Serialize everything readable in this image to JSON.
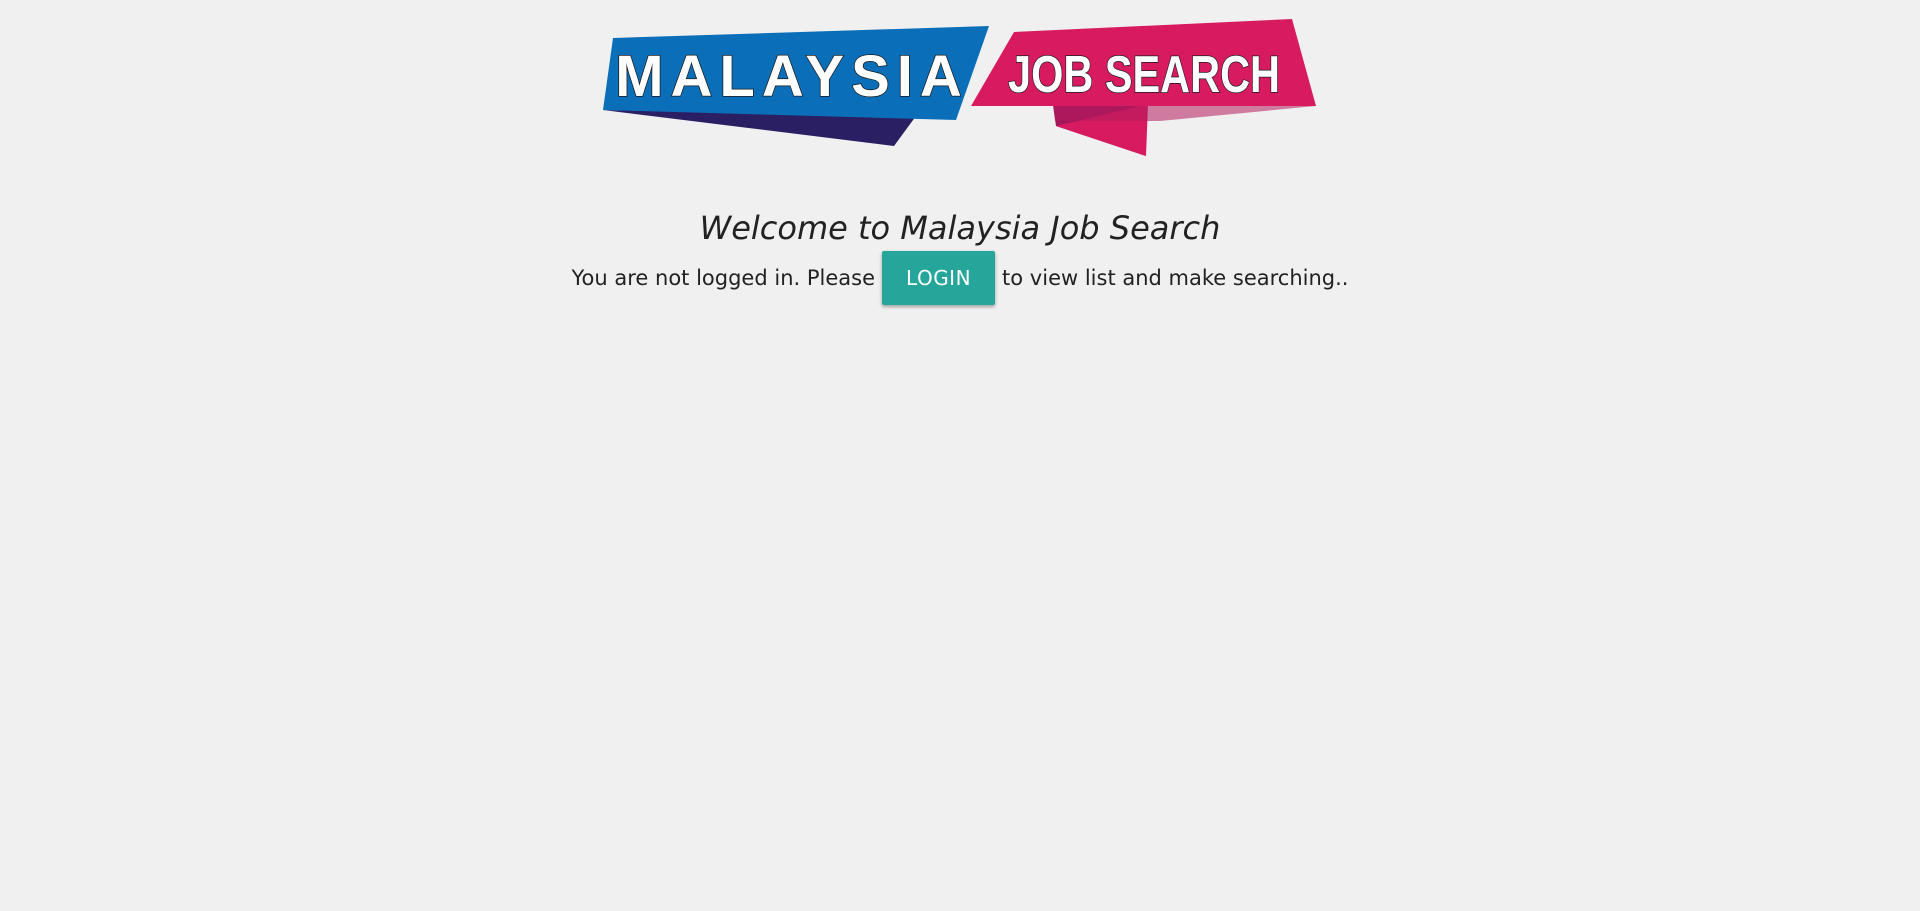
{
  "logo": {
    "word_left": "MALAYSIA",
    "word_right": "JOB SEARCH",
    "colors": {
      "blue": "#0a6fb8",
      "navy": "#2b1f63",
      "pink": "#d81b60",
      "dark_pink": "#a3175a"
    }
  },
  "welcome": {
    "title": "Welcome to Malaysia Job Search"
  },
  "message": {
    "before": "You are not logged in. Please",
    "after": "to view list and make searching.."
  },
  "login_button": {
    "label": "LOGIN",
    "color": "#26a69a"
  }
}
